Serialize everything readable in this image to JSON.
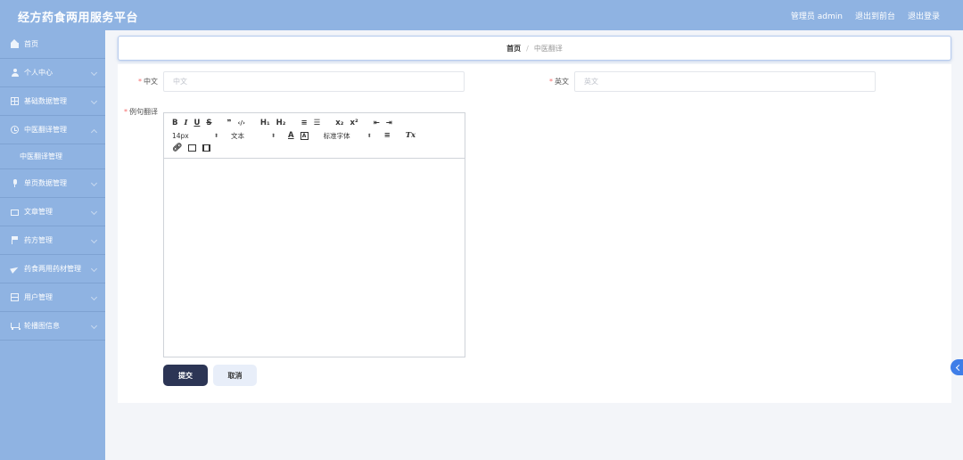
{
  "header": {
    "app_title": "经方药食两用服务平台",
    "admin_label": "管理员 admin",
    "back_to_front": "退出到前台",
    "logout": "退出登录"
  },
  "sidebar": {
    "items": [
      {
        "label": "首页",
        "icon": "home-icon"
      },
      {
        "label": "个人中心",
        "icon": "user-icon"
      },
      {
        "label": "基础数据管理",
        "icon": "grid-icon"
      },
      {
        "label": "中医翻译管理",
        "icon": "clock-icon",
        "expanded": true
      },
      {
        "label": "单页数据管理",
        "icon": "mic-icon"
      },
      {
        "label": "文章管理",
        "icon": "card-icon"
      },
      {
        "label": "药方管理",
        "icon": "flag-icon"
      },
      {
        "label": "药食两用药材管理",
        "icon": "plane-icon"
      },
      {
        "label": "用户管理",
        "icon": "table-icon"
      },
      {
        "label": "轮播图信息",
        "icon": "cart-icon"
      }
    ],
    "submenu": {
      "label": "中医翻译管理"
    }
  },
  "breadcrumb": {
    "home": "首页",
    "separator": "/",
    "current": "中医翻译"
  },
  "form": {
    "chinese": {
      "label": "中文",
      "placeholder": "中文"
    },
    "english": {
      "label": "英文",
      "placeholder": "英文"
    },
    "example": {
      "label": "例句翻译"
    }
  },
  "editor": {
    "toolbar": {
      "bold": "B",
      "italic": "I",
      "underline": "U",
      "strike": "S",
      "blockquote": "❞",
      "code": "‹/›",
      "h1": "H₁",
      "h2": "H₂",
      "ordered_list": "≡",
      "bullet_list": "☰",
      "subscript": "x₂",
      "superscript": "x²",
      "indent_left": "⇤",
      "indent_right": "⇥",
      "font_size": "14px",
      "text_style": "文本",
      "font_color": "A",
      "font_bg": "A",
      "font_family": "标准字体",
      "align": "≡",
      "clean": "Tx"
    }
  },
  "buttons": {
    "submit": "提交",
    "cancel": "取消"
  },
  "colors": {
    "sidebar_bg": "#8fb3e2",
    "submit_bg": "#2c3555",
    "required": "#f56c6c",
    "handle": "#3f7ee8"
  }
}
